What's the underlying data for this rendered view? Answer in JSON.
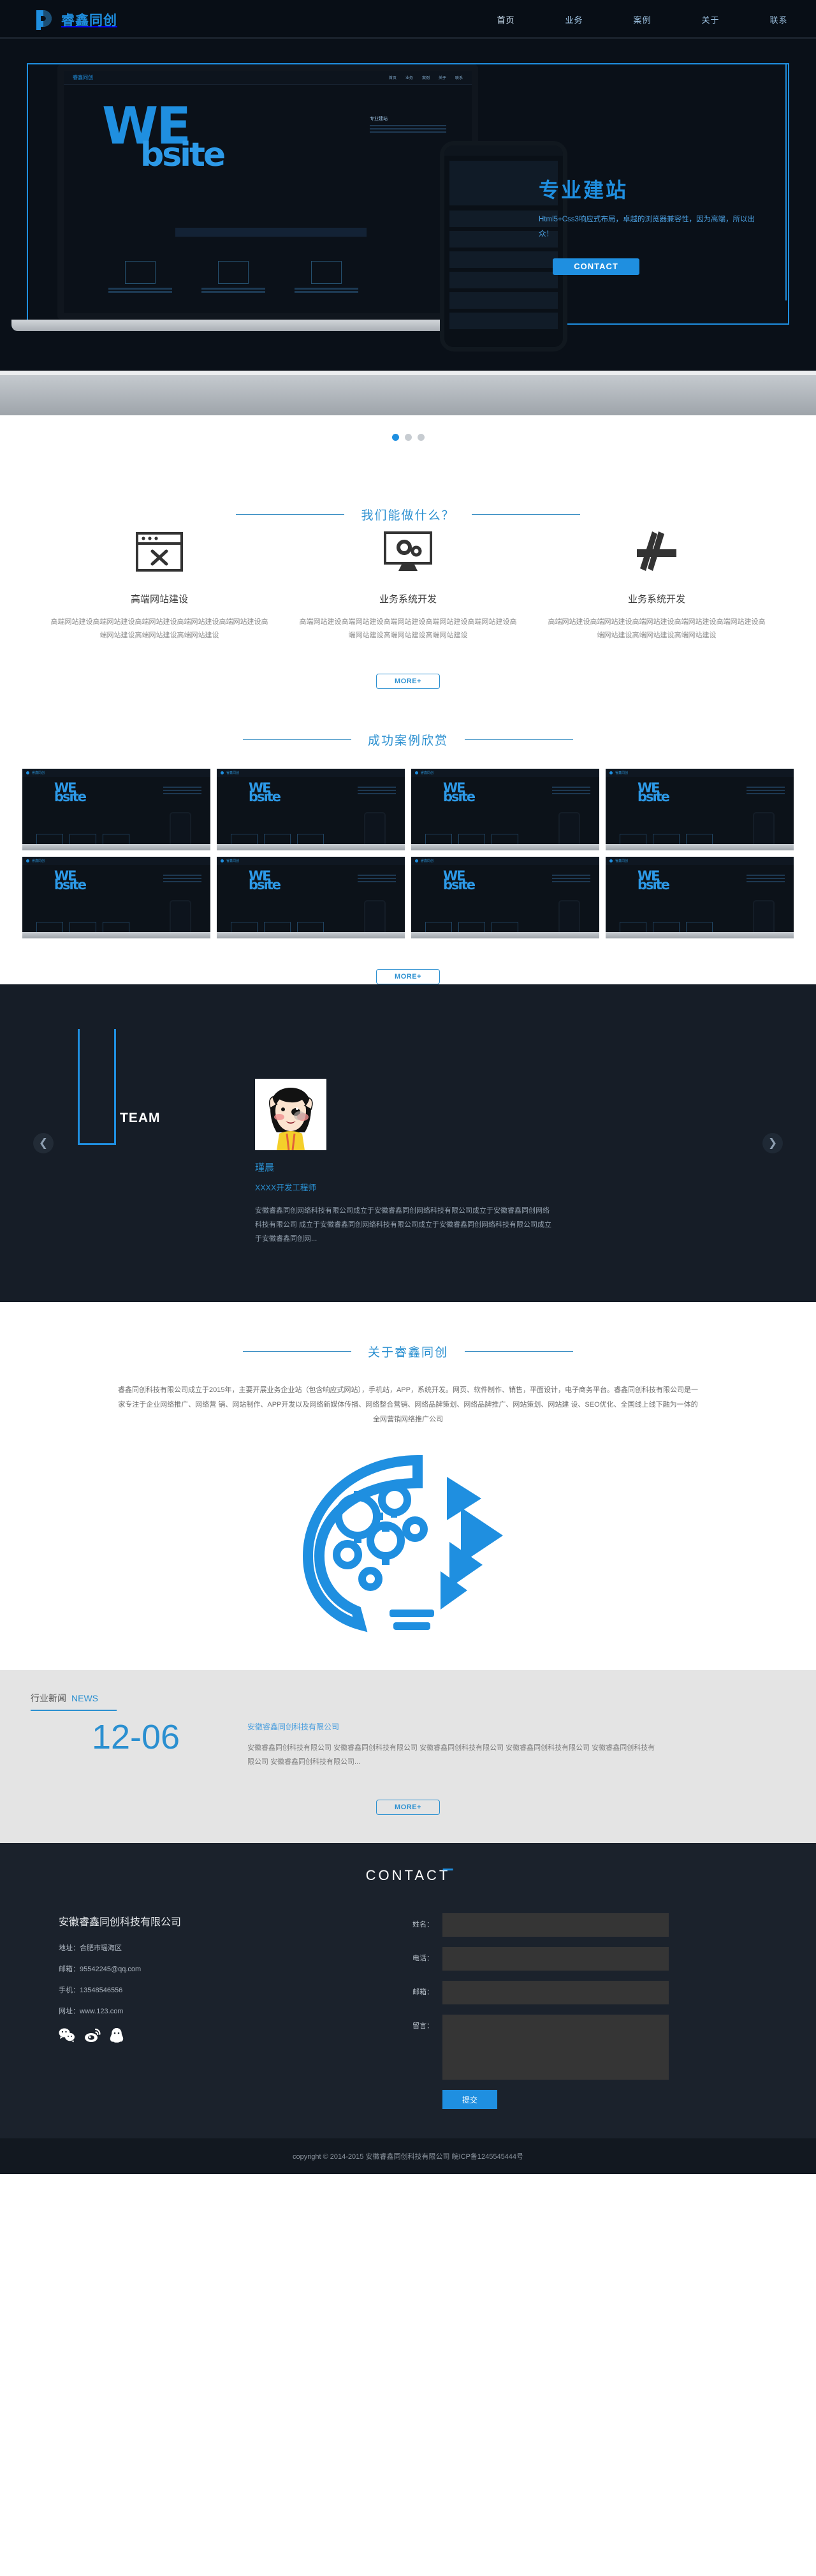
{
  "brand": {
    "name": "睿鑫同创",
    "logo_icon": "brand-logo-icon",
    "accent": "#1f8fe0"
  },
  "nav": {
    "items": [
      {
        "label": "首页"
      },
      {
        "label": "业务"
      },
      {
        "label": "案例"
      },
      {
        "label": "关于"
      },
      {
        "label": "联系"
      }
    ]
  },
  "hero": {
    "title": "专业建站",
    "subtitle": "Html5+Css3响应式布局，卓越的浏览器兼容性，因为高端，所以出众！",
    "button": "CONTACT",
    "mockup": {
      "word_top": "WE",
      "word_bottom": "bsite",
      "mini_logo": "睿鑫同创",
      "mini_links": [
        "首页",
        "业务",
        "案例",
        "关于",
        "联系"
      ],
      "side_title": "专业建站"
    },
    "carousel_dots": [
      true,
      false,
      false
    ]
  },
  "services": {
    "title": "我们能做什么？",
    "items": [
      {
        "icon": "browser-tools-icon",
        "title": "高端网站建设",
        "desc": "高端网站建设高端网站建设高端网站建设高端网站建设高端网站建设高端网站建设高端网站建设高端网站建设"
      },
      {
        "icon": "monitor-gears-icon",
        "title": "业务系统开发",
        "desc": "高端网站建设高端网站建设高端网站建设高端网站建设高端网站建设高端网站建设高端网站建设高端网站建设"
      },
      {
        "icon": "app-store-icon",
        "title": "业务系统开发",
        "desc": "高端网站建设高端网站建设高端网站建设高端网站建设高端网站建设高端网站建设高端网站建设高端网站建设"
      }
    ],
    "more_label": "MORE+"
  },
  "cases": {
    "title": "成功案例欣赏",
    "more_label": "MORE+",
    "items": [
      {
        "word_top": "WE",
        "word_bottom": "bsite",
        "logo": "睿鑫同创"
      },
      {
        "word_top": "WE",
        "word_bottom": "bsite",
        "logo": "睿鑫同创"
      },
      {
        "word_top": "WE",
        "word_bottom": "bsite",
        "logo": "睿鑫同创"
      },
      {
        "word_top": "WE",
        "word_bottom": "bsite",
        "logo": "睿鑫同创"
      },
      {
        "word_top": "WE",
        "word_bottom": "bsite",
        "logo": "睿鑫同创"
      },
      {
        "word_top": "WE",
        "word_bottom": "bsite",
        "logo": "睿鑫同创"
      },
      {
        "word_top": "WE",
        "word_bottom": "bsite",
        "logo": "睿鑫同创"
      },
      {
        "word_top": "WE",
        "word_bottom": "bsite",
        "logo": "睿鑫同创"
      }
    ]
  },
  "team": {
    "label": "TEAM",
    "prev_icon": "chevron-left-icon",
    "next_icon": "chevron-right-icon",
    "member": {
      "avatar": "team-member-avatar",
      "name": "瑾晨",
      "role": "XXXX开发工程师",
      "desc": "安徽睿鑫同创网络科技有限公司成立于安徽睿鑫同创网络科技有限公司成立于安徽睿鑫同创网络科技有限公司 成立于安徽睿鑫同创网络科技有限公司成立于安徽睿鑫同创网络科技有限公司成立于安徽睿鑫同创网..."
    }
  },
  "about": {
    "title": "关于睿鑫同创",
    "text": "睿鑫同创科技有限公司成立于2015年，主要开展业务企业站（包含响应式网站），手机站，APP，系统开发。网页、软件制作、销售，平面设计，电子商务平台。睿鑫同创科技有限公司是一家专注于企业网络推广、网络营 销、网站制作、APP开发以及网络新媒体传播、网络整合营销、网络品牌策划、网络品牌推广、网站策划、网站建 设、SEO优化、全国线上线下融为一体的全网营销网络推广公司",
    "illustration": "lightbulb-gears-icon"
  },
  "news": {
    "heading": "行业新闻",
    "heading_en": "NEWS",
    "items": [
      {
        "date": "12-06",
        "title": "安徽睿鑫同创科技有限公司",
        "summary": "安徽睿鑫同创科技有限公司 安徽睿鑫同创科技有限公司 安徽睿鑫同创科技有限公司 安徽睿鑫同创科技有限公司 安徽睿鑫同创科技有限公司 安徽睿鑫同创科技有限公司..."
      }
    ],
    "more_label": "MORE+"
  },
  "contact": {
    "heading": "CONTACT",
    "company": "安徽睿鑫同创科技有限公司",
    "address": "地址：合肥市瑶海区",
    "email": "邮箱：95542245@qq.com",
    "phone": "手机：13548546556",
    "website": "网址：www.123.com",
    "socials": [
      {
        "icon": "wechat-icon"
      },
      {
        "icon": "weibo-icon"
      },
      {
        "icon": "qq-icon"
      }
    ],
    "form": {
      "name_label": "姓名：",
      "name_value": "",
      "phone_label": "电话：",
      "phone_value": "",
      "email_label": "邮箱：",
      "email_value": "",
      "message_label": "留言：",
      "message_value": "",
      "submit_label": "提交"
    }
  },
  "footer": {
    "copyright": "copyright © 2014-2015 安徽睿鑫同创科技有限公司 皖ICP备1245545444号"
  }
}
